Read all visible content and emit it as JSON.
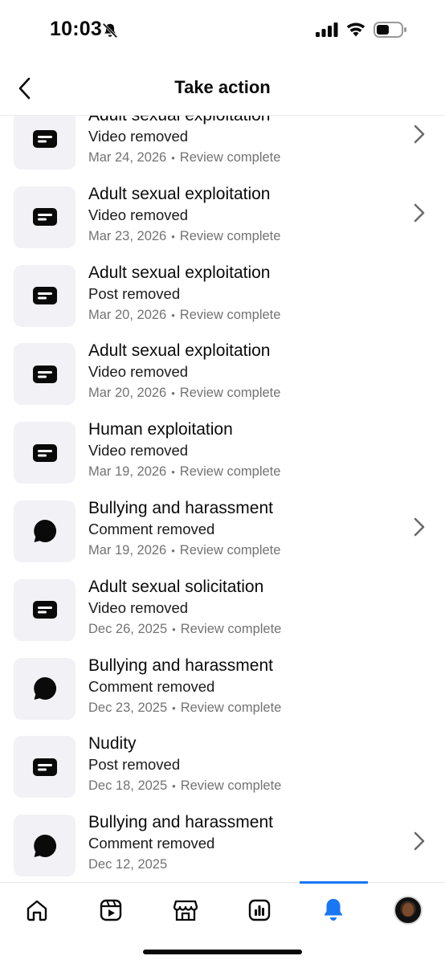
{
  "status_bar": {
    "time": "10:03"
  },
  "header": {
    "title": "Take action"
  },
  "items": [
    {
      "icon": "post",
      "title": "Adult sexual exploitation",
      "action": "Video removed",
      "date": "Mar 24, 2026",
      "status": "Review complete",
      "chevron": true
    },
    {
      "icon": "post",
      "title": "Adult sexual exploitation",
      "action": "Video removed",
      "date": "Mar 23, 2026",
      "status": "Review complete",
      "chevron": true
    },
    {
      "icon": "post",
      "title": "Adult sexual exploitation",
      "action": "Post removed",
      "date": "Mar 20, 2026",
      "status": "Review complete",
      "chevron": false
    },
    {
      "icon": "post",
      "title": "Adult sexual exploitation",
      "action": "Video removed",
      "date": "Mar 20, 2026",
      "status": "Review complete",
      "chevron": false
    },
    {
      "icon": "post",
      "title": "Human exploitation",
      "action": "Video removed",
      "date": "Mar 19, 2026",
      "status": "Review complete",
      "chevron": false
    },
    {
      "icon": "comment",
      "title": "Bullying and harassment",
      "action": "Comment removed",
      "date": "Mar 19, 2026",
      "status": "Review complete",
      "chevron": true
    },
    {
      "icon": "post",
      "title": "Adult sexual solicitation",
      "action": "Video removed",
      "date": "Dec 26, 2025",
      "status": "Review complete",
      "chevron": false
    },
    {
      "icon": "comment",
      "title": "Bullying and harassment",
      "action": "Comment removed",
      "date": "Dec 23, 2025",
      "status": "Review complete",
      "chevron": false
    },
    {
      "icon": "post",
      "title": "Nudity",
      "action": "Post removed",
      "date": "Dec 18, 2025",
      "status": "Review complete",
      "chevron": false
    },
    {
      "icon": "comment",
      "title": "Bullying and harassment",
      "action": "Comment removed",
      "date": "Dec 12, 2025",
      "status": "",
      "chevron": true
    }
  ],
  "meta_separator": "•",
  "bottom_nav": [
    {
      "name": "home-icon",
      "active": false
    },
    {
      "name": "video-icon",
      "active": false
    },
    {
      "name": "marketplace-icon",
      "active": false
    },
    {
      "name": "dashboard-icon",
      "active": false
    },
    {
      "name": "bell-icon",
      "active": true
    },
    {
      "name": "profile-avatar",
      "active": false
    }
  ],
  "colors": {
    "accent": "#1877f2",
    "thumb_bg": "#f2f2f6",
    "meta_text": "#737373"
  }
}
